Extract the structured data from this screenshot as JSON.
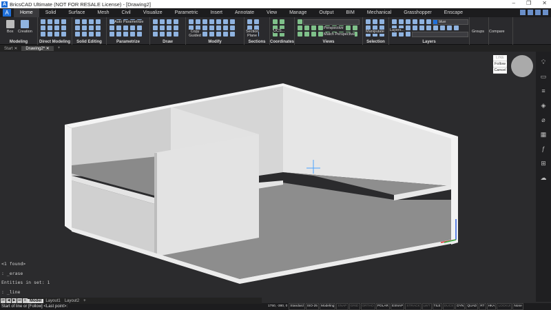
{
  "title": "BricsCAD Ultimate (NOT FOR RESALE License) - [Drawing2]",
  "window_controls": [
    "–",
    "❐",
    "✕"
  ],
  "tabs": [
    "Home",
    "Solid",
    "Surface",
    "Mesh",
    "Civil",
    "Visualize",
    "Parametric",
    "Insert",
    "Annotate",
    "View",
    "Manage",
    "Output",
    "BIM",
    "Mechanical",
    "Grasshopper",
    "Enscape"
  ],
  "ribbon": {
    "panels": [
      "Modeling",
      "Direct Modeling",
      "Solid Editing",
      "Parametrize",
      "Draw",
      "Modify",
      "Sections",
      "Coordinates",
      "Views",
      "Selection",
      "Layers",
      "",
      ""
    ],
    "box": "Box",
    "creation": "Creation",
    "auto_parametrize": "Auto Parametrize",
    "copy_guided": "Copy Guided",
    "section_plane": "Section Plane",
    "ucs": "UCS...",
    "perspective": "Perspective",
    "match_perspective": "Match Perspective",
    "manipulate": "Manipulate",
    "layers_btn": "Layers...",
    "layer_value": "blue",
    "layer_color": "#1e6fd9",
    "groups": "Groups",
    "compare": "Compare"
  },
  "doc_tabs": [
    "Start",
    "Drawing2*"
  ],
  "context_menu": {
    "header": "LINE",
    "items": [
      "Follow",
      "Cancel"
    ]
  },
  "command_history": [
    "<1 found>",
    ": _erase",
    "Entities in set: 1",
    ": _line"
  ],
  "layout_tabs": [
    "Model",
    "Layout1",
    "Layout2",
    "+"
  ],
  "prompt": "Start of line or [Follow] <Last point>:",
  "status": {
    "coords": "1750, -380, 0",
    "items": [
      {
        "t": "Standard",
        "on": true
      },
      {
        "t": "ISO-25",
        "on": true
      },
      {
        "t": "Modeling",
        "on": true
      },
      {
        "t": "SNAP",
        "on": false
      },
      {
        "t": "GRID",
        "on": false
      },
      {
        "t": "ORTHO",
        "on": false
      },
      {
        "t": "POLAR",
        "on": true
      },
      {
        "t": "ESNAP",
        "on": true
      },
      {
        "t": "STRACK",
        "on": false
      },
      {
        "t": "LWT",
        "on": false
      },
      {
        "t": "TILE",
        "on": true
      },
      {
        "t": "DUCS",
        "on": false
      },
      {
        "t": "DYN",
        "on": true
      },
      {
        "t": "QUAD",
        "on": true
      },
      {
        "t": "RT",
        "on": true
      },
      {
        "t": "HKA",
        "on": true
      },
      {
        "t": "LOCKUI",
        "on": false
      },
      {
        "t": "None",
        "on": true
      }
    ]
  }
}
